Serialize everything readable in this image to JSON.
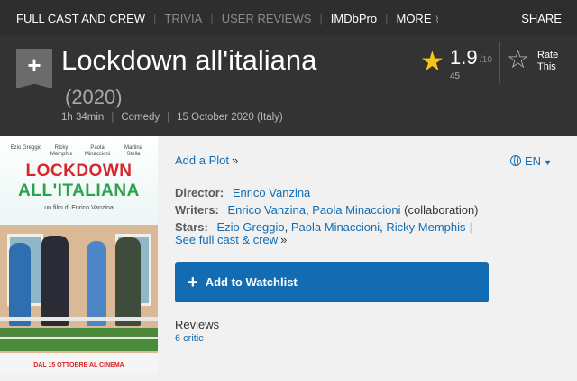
{
  "nav": {
    "items": [
      {
        "label": "FULL CAST AND CREW",
        "dim": false
      },
      {
        "label": "TRIVIA",
        "dim": true
      },
      {
        "label": "USER REVIEWS",
        "dim": true
      },
      {
        "label": "IMDbPro",
        "dim": false
      },
      {
        "label": "MORE",
        "dim": false
      }
    ],
    "more_icon": "chevron-double-down-icon",
    "share": "SHARE"
  },
  "title": {
    "name": "Lockdown all'italiana",
    "year": "(2020)",
    "bookmark_icon": "plus-bookmark-icon"
  },
  "meta": {
    "runtime": "1h 34min",
    "genre": "Comedy",
    "release": "15 October 2020 (Italy)"
  },
  "rating": {
    "value": "1.9",
    "max": "/10",
    "count": "45",
    "star_icon": "star-icon",
    "rate_label_1": "Rate",
    "rate_label_2": "This"
  },
  "poster": {
    "cast_top": [
      "Ezio Greggio",
      "Ricky Memphis",
      "Paola Minaccioni",
      "Martina Stella"
    ],
    "title_line1": "LOCKDOWN",
    "title_line2": "ALL'ITALIANA",
    "director_line": "un film di Enrico Vanzina",
    "release_line": "DAL 15 OTTOBRE AL CINEMA"
  },
  "details": {
    "add_plot": "Add a Plot",
    "language": "EN",
    "director_label": "Director:",
    "director": "Enrico Vanzina",
    "writers_label": "Writers:",
    "writer1": "Enrico Vanzina",
    "writer2": "Paola Minaccioni",
    "writer2_note": "(collaboration)",
    "stars_label": "Stars:",
    "star1": "Ezio Greggio",
    "star2": "Paola Minaccioni",
    "star3": "Ricky Memphis",
    "see_cast": "See full cast & crew",
    "watchlist": "Add to Watchlist",
    "reviews_label": "Reviews",
    "reviews_critic": "6 critic"
  },
  "colors": {
    "accent_blue": "#136cb2",
    "star_yellow": "#f5c518",
    "header_bg": "#333333",
    "nav_bg": "#2e2e2e"
  }
}
